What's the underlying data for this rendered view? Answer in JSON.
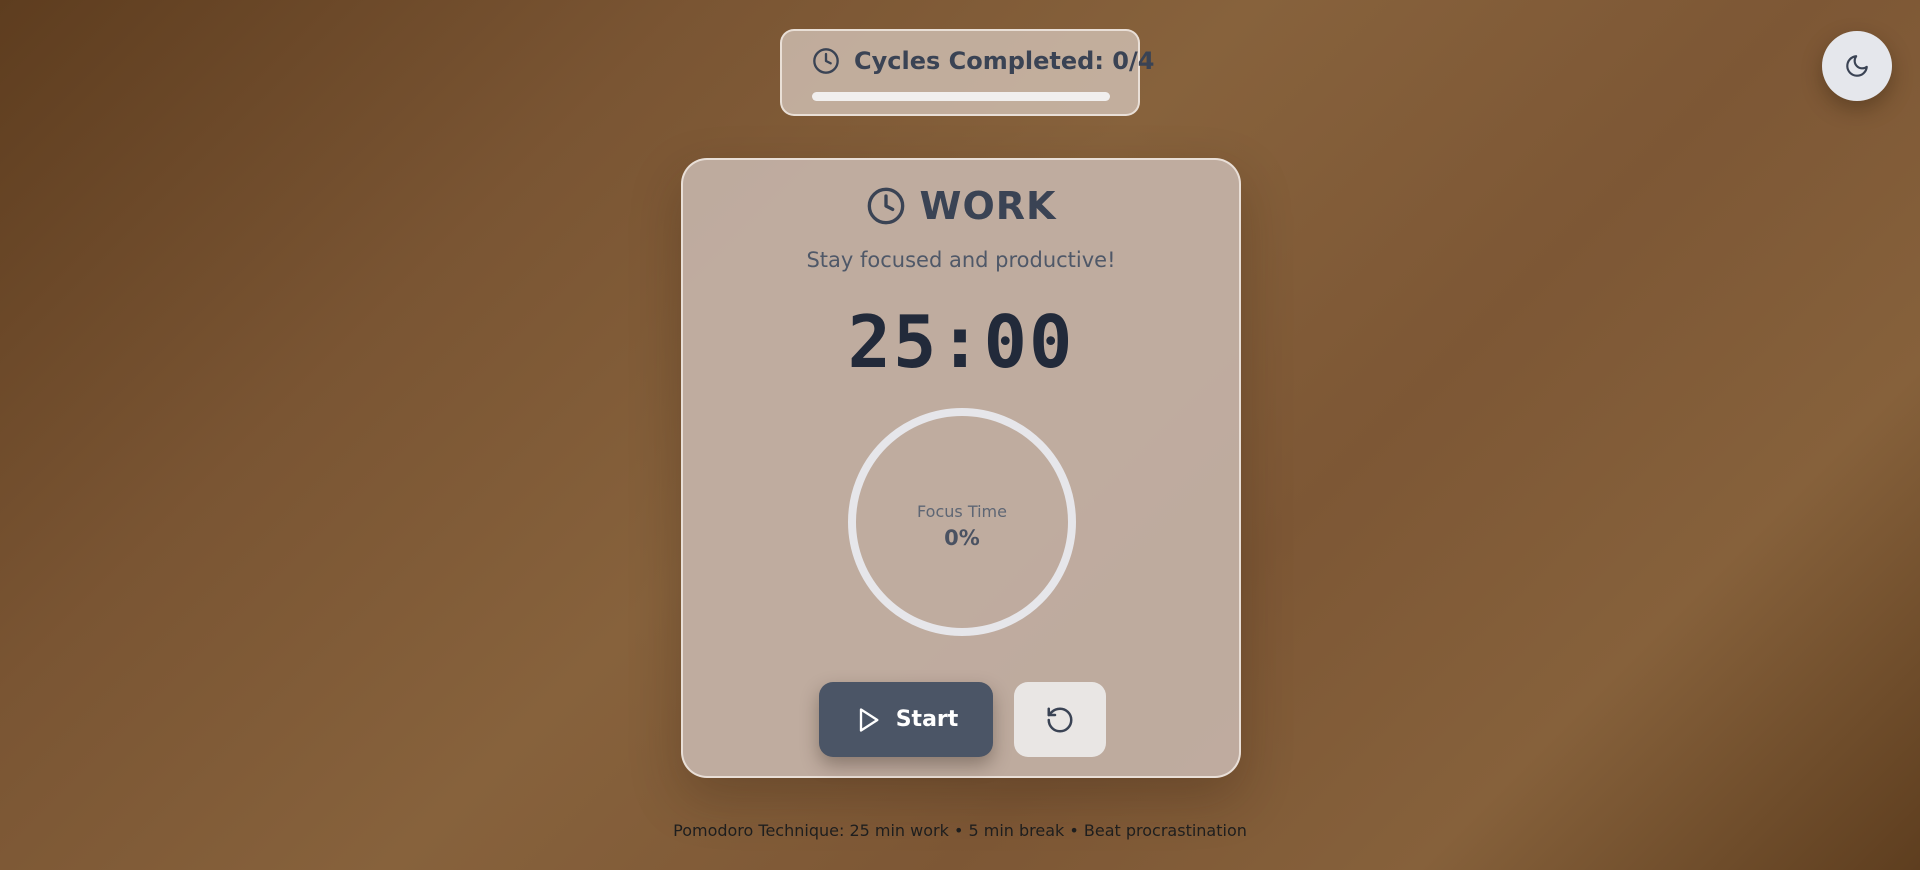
{
  "cycles": {
    "text": "Cycles Completed: 0/4",
    "completed": 0,
    "total": 4,
    "icon": "clock-icon"
  },
  "theme_toggle": {
    "icon": "moon-icon"
  },
  "timer_card": {
    "mode_icon": "clock-icon",
    "mode": "WORK",
    "subtitle": "Stay focused and productive!",
    "time": "25:00",
    "progress_label": "Focus Time",
    "progress_text": "0%",
    "progress_fraction": 0,
    "start_label": "Start",
    "start_icon": "play-icon",
    "reset_icon": "reset-icon"
  },
  "footer": {
    "text": "Pomodoro Technique: 25 min work • 5 min break • Beat procrastination"
  },
  "colors": {
    "primary": "#4b5566",
    "card": "#c2b0a4",
    "ring_track": "#e6e6ea",
    "text_dark": "#3a4354"
  }
}
